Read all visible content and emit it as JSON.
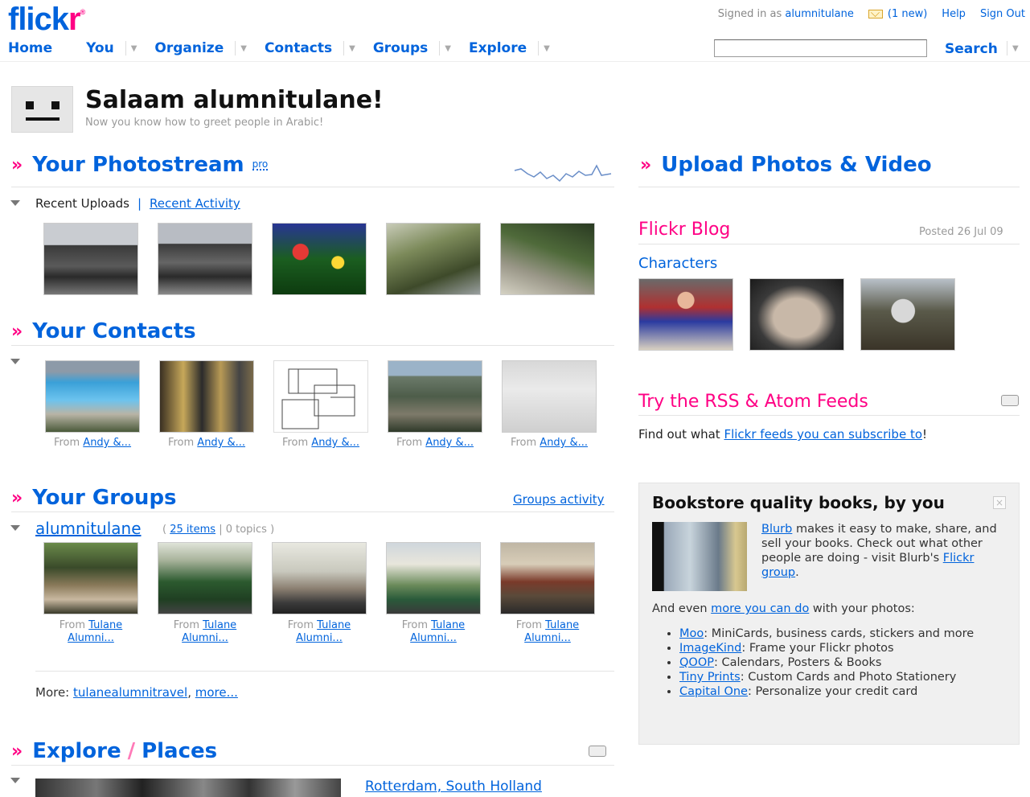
{
  "header": {
    "logo_a": "flick",
    "logo_b": "r",
    "logo_mark": "®",
    "signed_in_prefix": "Signed in as",
    "username": "alumnitulane",
    "mail_icon": "envelope-icon",
    "mail_count": "(1 new)",
    "help": "Help",
    "sign_out": "Sign Out"
  },
  "nav": {
    "items": [
      "Home",
      "You",
      "Organize",
      "Contacts",
      "Groups",
      "Explore"
    ],
    "search_label": "Search"
  },
  "greeting": {
    "title": "Salaam alumnitulane!",
    "subtitle": "Now you know how to greet people in Arabic!"
  },
  "photostream": {
    "title": "Your Photostream",
    "pro": "pro",
    "tab_recent_uploads": "Recent Uploads",
    "tab_separator": "|",
    "tab_recent_activity": "Recent Activity",
    "thumbs": [
      {
        "colors": [
          "#6b7280",
          "#2b2b2b",
          "#8a8a8a"
        ]
      },
      {
        "colors": [
          "#7a7f88",
          "#333333",
          "#9aa0a8"
        ]
      },
      {
        "colors": [
          "#1b5e20",
          "#283593",
          "#e53935"
        ]
      },
      {
        "colors": [
          "#7c8a5a",
          "#3e4a2a",
          "#b0b6a0"
        ]
      },
      {
        "colors": [
          "#4f6a3a",
          "#2a3a22",
          "#c9cbb6"
        ]
      }
    ]
  },
  "contacts": {
    "title": "Your Contacts",
    "items": [
      {
        "from": "From",
        "who": "Andy &..."
      },
      {
        "from": "From",
        "who": "Andy &..."
      },
      {
        "from": "From",
        "who": "Andy &..."
      },
      {
        "from": "From",
        "who": "Andy &..."
      },
      {
        "from": "From",
        "who": "Andy &..."
      }
    ]
  },
  "groups": {
    "title": "Your Groups",
    "activity": "Groups activity",
    "group_name": "alumnitulane",
    "items_count": "25 items",
    "topics": "| 0 topics )",
    "open_paren": "(",
    "photos": [
      {
        "from": "From",
        "l1": "Tulane",
        "l2": "Alumni..."
      },
      {
        "from": "From",
        "l1": "Tulane",
        "l2": "Alumni..."
      },
      {
        "from": "From",
        "l1": "Tulane",
        "l2": "Alumni..."
      },
      {
        "from": "From",
        "l1": "Tulane",
        "l2": "Alumni..."
      },
      {
        "from": "From",
        "l1": "Tulane",
        "l2": "Alumni..."
      }
    ],
    "more_label": "More:",
    "more_group": "tulanealumnitravel",
    "more_link": "more..."
  },
  "explore": {
    "title_a": "Explore",
    "slash": "/",
    "title_b": "Places",
    "place": "Rotterdam, South Holland"
  },
  "upload": {
    "title": "Upload Photos & Video"
  },
  "blog": {
    "title": "Flickr Blog",
    "posted": "Posted 26 Jul 09",
    "post_title": "Characters"
  },
  "rss": {
    "title": "Try the RSS & Atom Feeds",
    "text_prefix": "Find out what",
    "link": "Flickr feeds you can subscribe to",
    "text_suffix": "!"
  },
  "promo": {
    "title": "Bookstore quality books, by you",
    "close": "×",
    "blurb_link": "Blurb",
    "blurb_text": "makes it easy to make, share, and sell your books. Check out what other people are doing - visit Blurb's",
    "blurb_group": "Flickr group",
    "blurb_end": ".",
    "more_prefix": "And even",
    "more_link": "more you can do",
    "more_suffix": "with your photos:",
    "list": [
      {
        "link": "Moo",
        "text": ": MiniCards, business cards, stickers and more"
      },
      {
        "link": "ImageKind",
        "text": ": Frame your Flickr photos"
      },
      {
        "link": "QOOP",
        "text": ": Calendars, Posters & Books"
      },
      {
        "link": "Tiny Prints",
        "text": ": Custom Cards and Photo Stationery"
      },
      {
        "link": "Capital One",
        "text": ": Personalize your credit card"
      }
    ]
  }
}
